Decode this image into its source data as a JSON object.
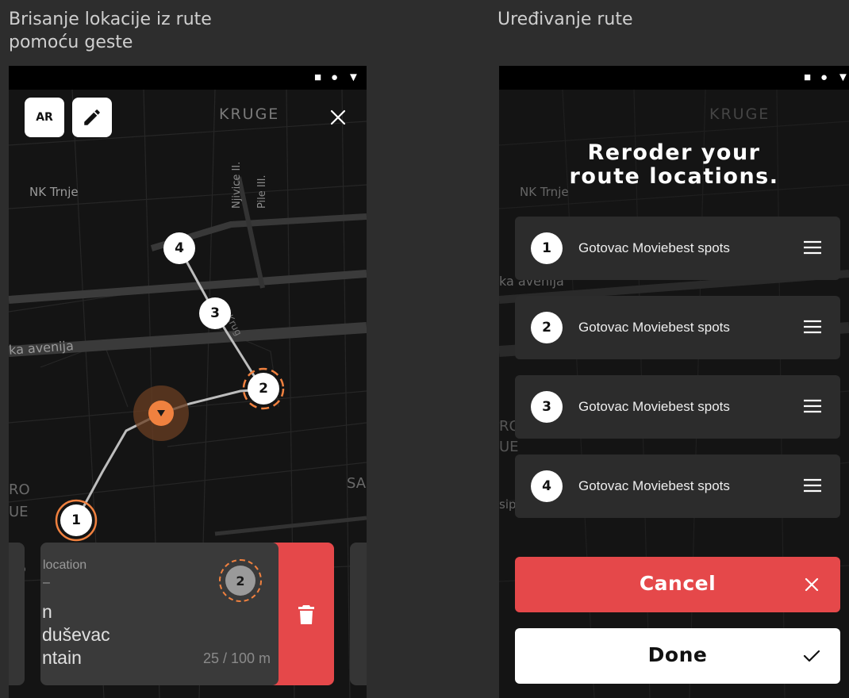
{
  "captions": {
    "left_line1": "Brisanje lokacije iz rute",
    "left_line2": "pomoću geste",
    "right": "Uređivanje rute"
  },
  "status_icons": [
    "square",
    "circle",
    "triangle-down"
  ],
  "map_labels": {
    "kruge": "KRUGE",
    "nk_trnje": "NK Trnje",
    "avenija": "ka avenija",
    "njivice": "Njivice II.",
    "pile": "Pile III.",
    "krug": "Krug",
    "ro": "RO",
    "ue": "UE",
    "sa": "SA",
    "sip": "sip"
  },
  "left_screen": {
    "ar_button": "AR",
    "edit_icon": "pencil-icon",
    "close_icon": "close-icon",
    "pins": [
      "4",
      "3",
      "2",
      "1"
    ],
    "swipe_card": {
      "label": "location",
      "dash": "–",
      "line1": "n",
      "line2": "duševac",
      "line3": "ntain",
      "pin_number": "2",
      "distance": "25 / 100 m",
      "delete_icon": "trash-icon"
    }
  },
  "right_screen": {
    "title_line1": "Reroder your",
    "title_line2": "route locations.",
    "rows": [
      {
        "number": "1",
        "name": "Gotovac Moviebest spots"
      },
      {
        "number": "2",
        "name": "Gotovac Moviebest spots"
      },
      {
        "number": "3",
        "name": "Gotovac Moviebest spots"
      },
      {
        "number": "4",
        "name": "Gotovac Moviebest spots"
      }
    ],
    "cancel_label": "Cancel",
    "done_label": "Done"
  },
  "colors": {
    "accent_orange": "#f0813f",
    "danger_red": "#e5484a",
    "background": "#2d2d2d",
    "screen": "#141414"
  }
}
